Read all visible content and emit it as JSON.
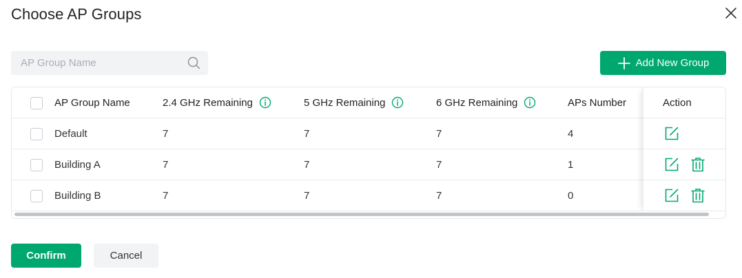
{
  "dialog": {
    "title": "Choose AP Groups"
  },
  "search": {
    "placeholder": "AP Group Name",
    "value": ""
  },
  "toolbar": {
    "add_label": "Add New Group"
  },
  "table": {
    "columns": {
      "name": "AP Group Name",
      "ghz24": "2.4 GHz Remaining",
      "ghz5": "5 GHz Remaining",
      "ghz6": "6 GHz Remaining",
      "aps": "APs Number",
      "action": "Action"
    },
    "rows": [
      {
        "name": "Default",
        "ghz24": "7",
        "ghz5": "7",
        "ghz6": "7",
        "aps": "4"
      },
      {
        "name": "Building A",
        "ghz24": "7",
        "ghz5": "7",
        "ghz6": "7",
        "aps": "1"
      },
      {
        "name": "Building B",
        "ghz24": "7",
        "ghz5": "7",
        "ghz6": "7",
        "aps": "0"
      }
    ]
  },
  "footer": {
    "confirm_label": "Confirm",
    "cancel_label": "Cancel"
  },
  "icons": {
    "close": "close-icon",
    "search": "search-icon",
    "add": "plus-icon",
    "info": "info-icon",
    "edit": "edit-icon",
    "delete": "trash-icon"
  },
  "colors": {
    "accent": "#00a870",
    "background": "#ffffff",
    "input_bg": "#f2f3f5"
  }
}
